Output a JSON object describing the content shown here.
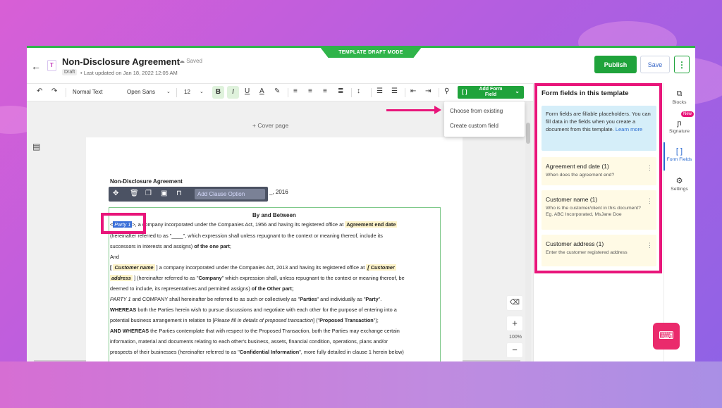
{
  "mode_label": "TEMPLATE DRAFT MODE",
  "header": {
    "doc_icon": "T",
    "title": "Non-Disclosure Agreement",
    "saved": "☁ Saved",
    "draft_badge": "Draft",
    "updated": "• Last updated on Jan 18, 2022 12:05 AM",
    "publish_label": "Publish",
    "save_label": "Save",
    "more_label": "⋮"
  },
  "toolbar": {
    "style": "Normal Text",
    "font": "Open Sans",
    "size": "12",
    "add_form_field": "Add Form Field"
  },
  "add_field_menu": {
    "items": [
      "Choose from existing",
      "Create custom field"
    ]
  },
  "canvas": {
    "cover_page": "+ Cover page",
    "clause_bar": {
      "add_clause": "Add Clause Option"
    },
    "zoom_level": "100%"
  },
  "document": {
    "title": "Non-Disclosure Agreement",
    "date_suffix": "_, 2016",
    "by_between": "By and Between",
    "lines": [
      {
        "parts": [
          {
            "t": "<",
            "c": ""
          },
          {
            "t": "Party 1",
            "c": "party-sel"
          },
          {
            "t": ">, a company incorporated under the Companies Act, 1956 and having its registered office at ",
            "c": ""
          },
          {
            "t": "Agreement end date",
            "c": "chip"
          }
        ]
      },
      {
        "parts": [
          {
            "t": "(hereinafter referred to as \"____\", which expression shall unless repugnant to the context or meaning thereof, include its",
            "c": ""
          }
        ]
      },
      {
        "parts": [
          {
            "t": "successors in interests and assigns) ",
            "c": ""
          },
          {
            "t": "of the one part",
            "c": "b"
          },
          {
            "t": ";",
            "c": ""
          }
        ]
      },
      {
        "parts": [
          {
            "t": "And",
            "c": ""
          }
        ]
      },
      {
        "parts": [
          {
            "t": "[ ",
            "c": "b"
          },
          {
            "t": "Customer name",
            "c": "chip-it"
          },
          {
            "t": " ] a company incorporated under the Companies Act, 2013 and having its registered office at ",
            "c": ""
          },
          {
            "t": "[ Customer",
            "c": "chip-it"
          }
        ]
      },
      {
        "parts": [
          {
            "t": "address",
            "c": "chip-it"
          },
          {
            "t": " ] (hereinafter referred to as \"",
            "c": ""
          },
          {
            "t": "Company",
            "c": "b"
          },
          {
            "t": "\" which expression shall, unless repugnant to the context or meaning thereof, be",
            "c": ""
          }
        ]
      },
      {
        "parts": [
          {
            "t": "deemed to include, its representatives and permitted assigns) ",
            "c": ""
          },
          {
            "t": "of the Other part;",
            "c": "b"
          }
        ]
      },
      {
        "parts": [
          {
            "t": "PARTY 1",
            "c": "i"
          },
          {
            "t": " and COMPANY shall hereinafter be referred to as such or collectively as \"",
            "c": ""
          },
          {
            "t": "Parties",
            "c": "b"
          },
          {
            "t": "\" and individually as \"",
            "c": ""
          },
          {
            "t": "Party",
            "c": "b"
          },
          {
            "t": "\".",
            "c": ""
          }
        ]
      },
      {
        "parts": [
          {
            "t": "WHEREAS",
            "c": "b"
          },
          {
            "t": " both the Parties herein wish to pursue discussions and negotiate with each other for the purpose of entering into a",
            "c": ""
          }
        ]
      },
      {
        "parts": [
          {
            "t": "potential business arrangement in relation to [",
            "c": ""
          },
          {
            "t": "Please fill in details of proposed transaction",
            "c": "i"
          },
          {
            "t": "] (\"",
            "c": ""
          },
          {
            "t": "Proposed Transaction",
            "c": "b"
          },
          {
            "t": "\");",
            "c": ""
          }
        ]
      },
      {
        "parts": [
          {
            "t": "AND WHEREAS",
            "c": "b"
          },
          {
            "t": " the Parties contemplate that with respect to the Proposed Transaction, both the Parties may exchange certain",
            "c": ""
          }
        ]
      },
      {
        "parts": [
          {
            "t": "information, material and documents relating to each other's business, assets, financial condition, operations, plans and/or",
            "c": ""
          }
        ]
      },
      {
        "parts": [
          {
            "t": "prospects of their businesses (hereinafter referred to as \"",
            "c": ""
          },
          {
            "t": "Confidential Information",
            "c": "b"
          },
          {
            "t": "\", more fully detailed in clause 1 herein below)",
            "c": ""
          }
        ]
      }
    ]
  },
  "form_fields_panel": {
    "title": "Form fields in this template",
    "info_text": "Form fields are fillable placeholders. You can fill data in the fields when you create a document from this template.",
    "learn_more": "Learn more",
    "fields": [
      {
        "name": "Agreement end date (1)",
        "description": "When does the agreement end?"
      },
      {
        "name": "Customer name (1)",
        "description": "Who is the customer/client in this document? Eg. ABC Incorporated, MsJane Doe"
      },
      {
        "name": "Customer address (1)",
        "description": "Enter the customer registered address"
      }
    ]
  },
  "rail": {
    "items": [
      {
        "label": "Blocks",
        "icon": "blocks-icon"
      },
      {
        "label": "Signature",
        "icon": "signature-icon",
        "badge": "New"
      },
      {
        "label": "Form Fields",
        "icon": "brackets-icon"
      },
      {
        "label": "Settings",
        "icon": "gear-icon"
      }
    ]
  },
  "colors": {
    "accent_green": "#1fa33b",
    "highlight_pink": "#e8157a",
    "chip_yellow": "#fdf3c9",
    "info_blue": "#d5eef9"
  }
}
